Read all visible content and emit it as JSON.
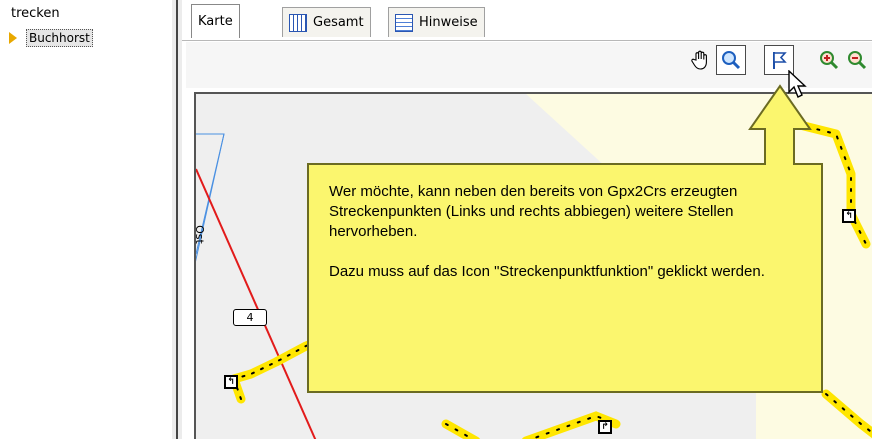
{
  "tree": {
    "root_label": "trecken",
    "item_label": "Buchhorst"
  },
  "tabs": [
    {
      "label": "Karte",
      "icon": "map-icon",
      "active": true
    },
    {
      "label": "Gesamt",
      "icon": "grid-icon",
      "active": false
    },
    {
      "label": "Hinweise",
      "icon": "note-icon",
      "active": false
    }
  ],
  "toolbar": {
    "icons": [
      "hand-icon",
      "zoom-select-icon",
      "flag-icon",
      "zoom-in-icon",
      "zoom-out-icon"
    ]
  },
  "map": {
    "street_label": "Ost",
    "km_marker": "4",
    "track_color": "#ffe600"
  },
  "callout": {
    "paragraph1": "Wer möchte, kann neben den bereits von Gpx2Crs erzeugten Streckenpunkten (Links und rechts abbiegen) weitere Stellen hervorheben.",
    "paragraph2": "Dazu muss auf das Icon \"Streckenpunktfunktion\" geklickt werden.",
    "fill_color": "#fbf66e"
  }
}
